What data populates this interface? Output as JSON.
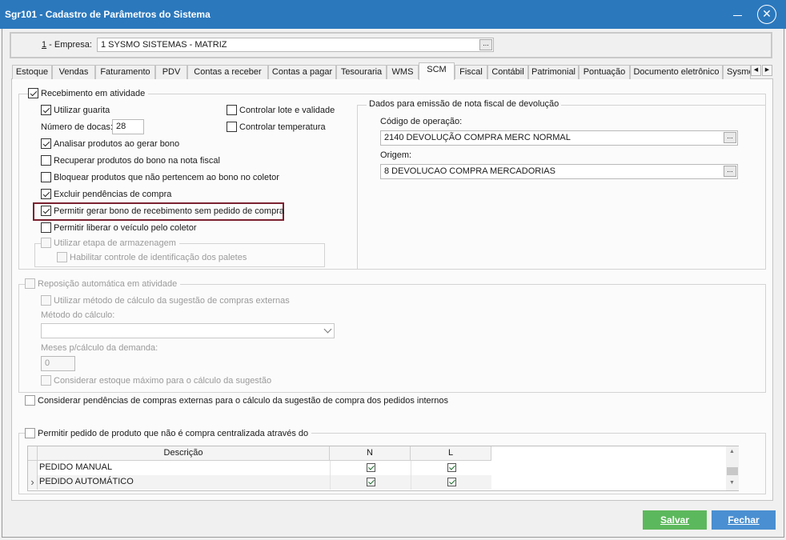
{
  "window": {
    "title": "Sgr101 - Cadastro de Parâmetros do Sistema",
    "close_glyph": "✕"
  },
  "company": {
    "label_num": "1",
    "label_text": " - Empresa:",
    "value": "1  SYSMO SISTEMAS - MATRIZ",
    "dots": "..."
  },
  "tabs": [
    {
      "label": "Estoque"
    },
    {
      "label": "Vendas"
    },
    {
      "label": "Faturamento"
    },
    {
      "label": "PDV"
    },
    {
      "label": "Contas a receber"
    },
    {
      "label": "Contas a pagar"
    },
    {
      "label": "Tesouraria"
    },
    {
      "label": "WMS"
    },
    {
      "label": "SCM"
    },
    {
      "label": "Fiscal"
    },
    {
      "label": "Contábil"
    },
    {
      "label": "Patrimonial"
    },
    {
      "label": "Pontuação"
    },
    {
      "label": "Documento eletrônico"
    },
    {
      "label": "Sysmo"
    }
  ],
  "receipt": {
    "title": "Recebimento em atividade",
    "use_guard": "Utilizar guarita",
    "docks_label": "Número de docas:",
    "docks_value": "28",
    "analyze_products": "Analisar produtos ao gerar bono",
    "recover_products": "Recuperar produtos do bono na nota fiscal",
    "block_products": "Bloquear produtos que não pertencem ao bono no coletor",
    "delete_pending": "Excluir pendências de compra",
    "allow_no_order": "Permitir gerar bono de recebimento sem pedido de compra",
    "allow_release_vehicle": "Permitir liberar o veículo pelo coletor",
    "control_lot": "Controlar lote e validade",
    "control_temp": "Controlar temperatura",
    "storage_step": "Utilizar etapa de armazenagem",
    "pallet_control": "Habilitar controle de identificação dos paletes"
  },
  "return_invoice": {
    "title": "Dados para emissão de nota fiscal de devolução",
    "op_label": "Código de operação:",
    "op_value": "2140 DEVOLUÇÃO COMPRA MERC NORMAL",
    "origin_label": "Origem:",
    "origin_value": "8   DEVOLUCAO COMPRA MERCADORIAS",
    "dots": "..."
  },
  "replenish": {
    "title": "Reposição automática em atividade",
    "use_method": "Utilizar método de cálculo da sugestão de compras externas",
    "method_label": "Método do cálculo:",
    "months_label": "Meses p/cálculo da demanda:",
    "months_value": "0",
    "consider_max": "Considerar estoque máximo para o cálculo da sugestão"
  },
  "consider_pending": "Considerar pendências de compras externas para o cálculo da sugestão de compra dos pedidos internos",
  "central": {
    "title": "Permitir pedido de produto que não é compra centralizada através do",
    "columns": [
      "Descrição",
      "N",
      "L"
    ],
    "rows": [
      {
        "desc": "PEDIDO MANUAL",
        "n": true,
        "l": true
      },
      {
        "desc": "PEDIDO AUTOMÁTICO",
        "n": true,
        "l": true
      }
    ],
    "row_marker": "›"
  },
  "buttons": {
    "save": "Salvar",
    "close": "Fechar"
  }
}
